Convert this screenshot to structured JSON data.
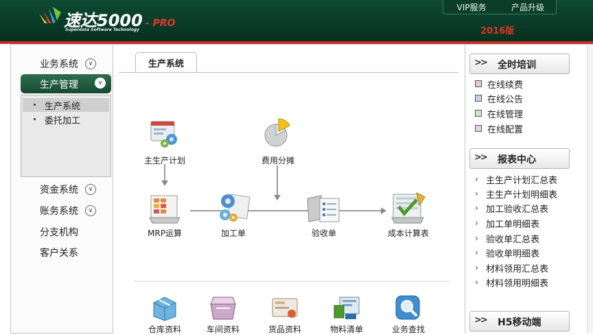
{
  "header": {
    "brand": "速达5000",
    "brand_suffix": "- PRO",
    "tagline": "Superdata Software Technology",
    "edition": "2016版",
    "nav": [
      "VIP服务",
      "产品升级"
    ]
  },
  "sidebar": {
    "groups": [
      {
        "label": "业务系统"
      },
      {
        "label": "生产管理",
        "active": true
      },
      {
        "label": "资金系统"
      },
      {
        "label": "账务系统"
      },
      {
        "label": "分支机构"
      },
      {
        "label": "客户关系"
      }
    ],
    "subitems": [
      {
        "label": "生产系统",
        "active": true
      },
      {
        "label": "委托加工"
      }
    ]
  },
  "main": {
    "tab": "生产系统",
    "flow": {
      "master_plan": "主生产计划",
      "cost_alloc": "费用分摊",
      "mrp": "MRP运算",
      "work_order": "加工单",
      "acceptance": "验收单",
      "cost_calc": "成本计算表"
    },
    "bottom": [
      "仓库资料",
      "车间资料",
      "货品资料",
      "物料清单",
      "业务查找"
    ]
  },
  "right": {
    "training": {
      "title": "全时培训",
      "items": [
        "在线续费",
        "在线公告",
        "在线管理",
        "在线配置"
      ]
    },
    "reports": {
      "title": "报表中心",
      "items": [
        "主生产计划汇总表",
        "主生产计划明细表",
        "加工验收汇总表",
        "加工单明细表",
        "验收单汇总表",
        "验收单明细表",
        "材料领用汇总表",
        "材料领用明细表"
      ]
    },
    "mobile": {
      "title": "H5移动端"
    }
  },
  "colors": {
    "header_bg": "#0b3d2a",
    "accent_red": "#c62b26",
    "nav_active": "#1d553b"
  }
}
